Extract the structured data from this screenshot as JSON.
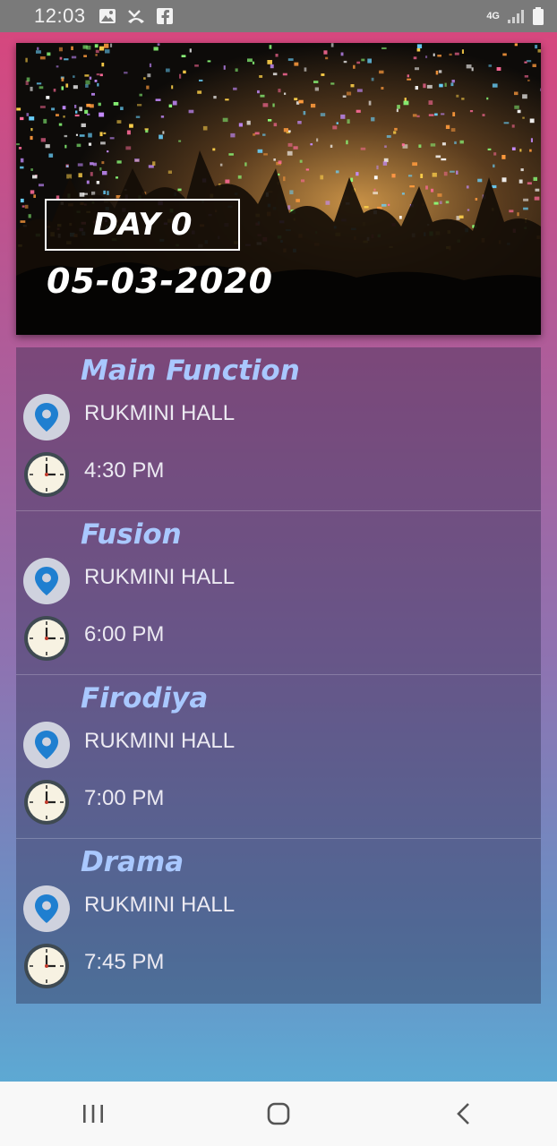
{
  "status_bar": {
    "time": "12:03",
    "network": "4G",
    "icons": [
      "gallery-icon",
      "missed-call-icon",
      "facebook-icon",
      "signal-icon",
      "battery-icon"
    ]
  },
  "hero": {
    "day_label": "DAY 0",
    "date": "05-03-2020"
  },
  "events": [
    {
      "title": "Main Function",
      "venue": "RUKMINI HALL",
      "time": "4:30 PM"
    },
    {
      "title": "Fusion",
      "venue": "RUKMINI HALL",
      "time": "6:00 PM"
    },
    {
      "title": "Firodiya",
      "venue": "RUKMINI HALL",
      "time": "7:00 PM"
    },
    {
      "title": "Drama",
      "venue": "RUKMINI HALL",
      "time": "7:45 PM"
    }
  ],
  "nav_bar": {
    "buttons": [
      "recent-apps",
      "home",
      "back"
    ]
  },
  "colors": {
    "status_bar": "#7a7a7a",
    "gradient_top": "#d6477e",
    "gradient_bottom": "#5da9d3",
    "event_title": "#a9c8ff",
    "location_pin": "#1f7fd0"
  }
}
